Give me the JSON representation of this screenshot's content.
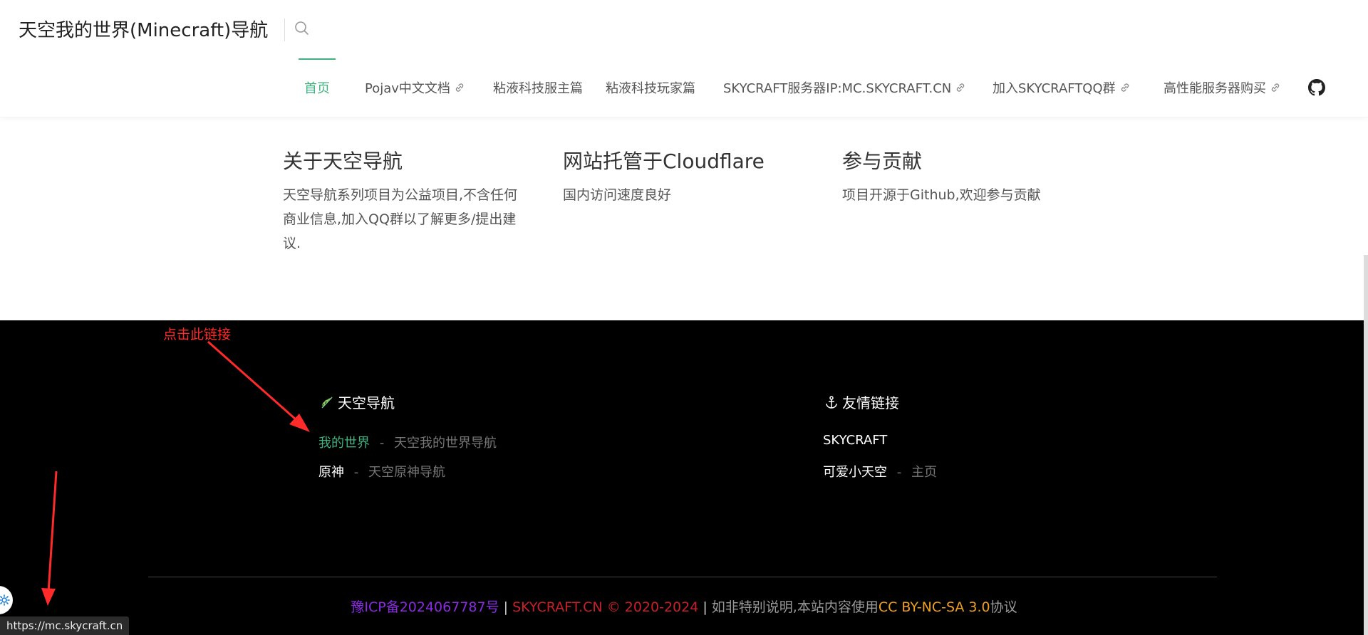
{
  "header": {
    "site_title": "天空我的世界(Minecraft)导航",
    "search_icon": "search-icon",
    "nav": [
      {
        "label": "首页",
        "active": true,
        "external": false
      },
      {
        "label": "Pojav中文文档",
        "active": false,
        "external": true
      },
      {
        "label": "粘液科技服主篇",
        "active": false,
        "external": false
      },
      {
        "label": "粘液科技玩家篇",
        "active": false,
        "external": false
      },
      {
        "label": "SKYCRAFT服务器IP:MC.SKYCRAFT.CN",
        "active": false,
        "external": true
      },
      {
        "label": "加入SKYCRAFTQQ群",
        "active": false,
        "external": true
      },
      {
        "label": "高性能服务器购买",
        "active": false,
        "external": true
      }
    ],
    "github_icon": "github-icon"
  },
  "features": [
    {
      "title": "关于天空导航",
      "desc": "天空导航系列项目为公益项目,不含任何商业信息,加入QQ群以了解更多/提出建议."
    },
    {
      "title": "网站托管于Cloudflare",
      "desc": "国内访问速度良好"
    },
    {
      "title": "参与贡献",
      "desc": "项目开源于Github,欢迎参与贡献"
    }
  ],
  "footer": {
    "col1_title": "天空导航",
    "col1_icon": "leaf-icon",
    "col1_links": [
      {
        "name": "我的世界",
        "sep": "-",
        "desc": "天空我的世界导航"
      },
      {
        "name": "原神",
        "sep": "-",
        "desc": "天空原神导航"
      }
    ],
    "col2_title": "友情链接",
    "col2_icon": "anchor-icon",
    "col2_links": [
      {
        "name": "SKYCRAFT",
        "sep": "",
        "desc": ""
      },
      {
        "name": "可爱小天空",
        "sep": "-",
        "desc": "主页"
      }
    ],
    "copyright": {
      "icp": "豫ICP备2024067787号",
      "bar1": " | ",
      "site": "SKYCRAFT.CN © 2020-2024",
      "bar2": " | ",
      "note": "如非特别说明,本站内容使用",
      "license": "CC BY-NC-SA 3.0",
      "suffix": "协议"
    }
  },
  "annotation": {
    "label": "点击此链接"
  },
  "status_bar": {
    "url": "https://mc.skycraft.cn"
  },
  "colors": {
    "accent": "#3fb27f",
    "annotation": "#ff2a2a",
    "icp": "#8a2be2",
    "site": "#c8202a",
    "license": "#f0a020"
  }
}
